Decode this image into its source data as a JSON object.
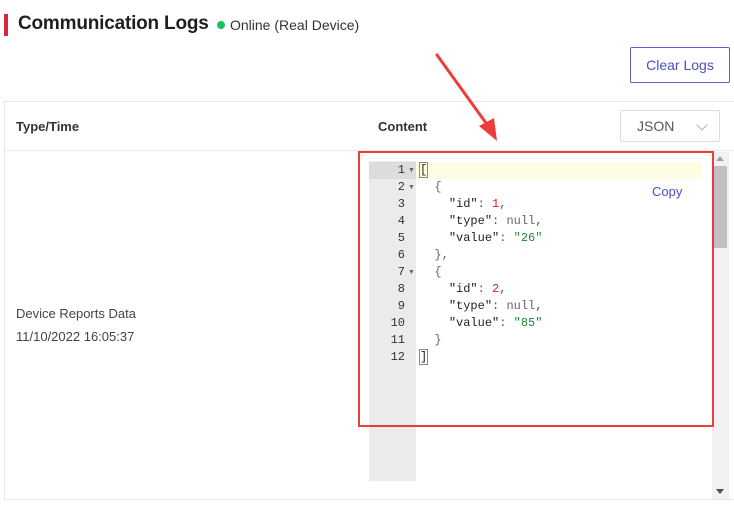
{
  "header": {
    "title": "Communication Logs",
    "status_text": "Online (Real Device)",
    "status_color": "#19c160",
    "accent_color": "#d9243a"
  },
  "toolbar": {
    "clear_label": "Clear Logs"
  },
  "table": {
    "columns": [
      "Type/Time",
      "Content"
    ],
    "format_select": {
      "selected": "JSON"
    },
    "rows": [
      {
        "type": "Device Reports Data",
        "time": "11/10/2022 16:05:37",
        "copy_label": "Copy",
        "line_numbers": [
          "1",
          "2",
          "3",
          "4",
          "5",
          "6",
          "7",
          "8",
          "9",
          "10",
          "11",
          "12"
        ]
      }
    ]
  },
  "code": {
    "line1": "[",
    "line2": "{",
    "line6": "},",
    "line7": "{",
    "line11": "}",
    "line12": "]",
    "id_key": "\"id\"",
    "type_key": "\"type\"",
    "value_key": "\"value\"",
    "id1": "1",
    "id2": "2",
    "null_text": "null",
    "value1": "\"26\"",
    "value2": "\"85\""
  },
  "icons": [
    "chevron-down-icon",
    "fold-arrow-icon",
    "arrow-annotation"
  ]
}
